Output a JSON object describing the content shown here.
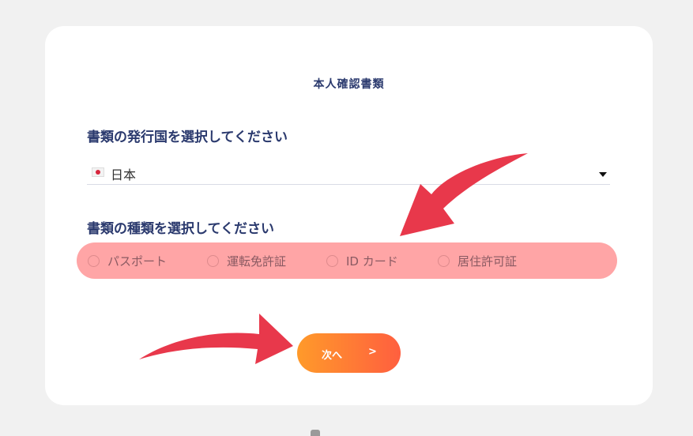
{
  "form": {
    "title": "本人確認書類",
    "country_label": "書類の発行国を選択してください",
    "country_value": "日本",
    "doctype_label": "書類の種類を選択してください",
    "doc_types": [
      {
        "label": "パスポート"
      },
      {
        "label": "運転免許証"
      },
      {
        "label": "ID カード"
      },
      {
        "label": "居住許可証"
      }
    ],
    "next_label": "次へ",
    "next_arrow": ">"
  },
  "icons": {
    "flag": "japan-flag-icon",
    "dropdown": "caret-down-icon",
    "radio": "radio-unchecked-icon",
    "annotation": "red-arrow-icon"
  },
  "colors": {
    "background": "#f1f1f1",
    "card": "#ffffff",
    "heading": "#2b3a6e",
    "highlight": "#ffa5a6",
    "button_start": "#ff9a2a",
    "button_end": "#ff5f3f",
    "annotation_arrow": "#e8384b"
  }
}
